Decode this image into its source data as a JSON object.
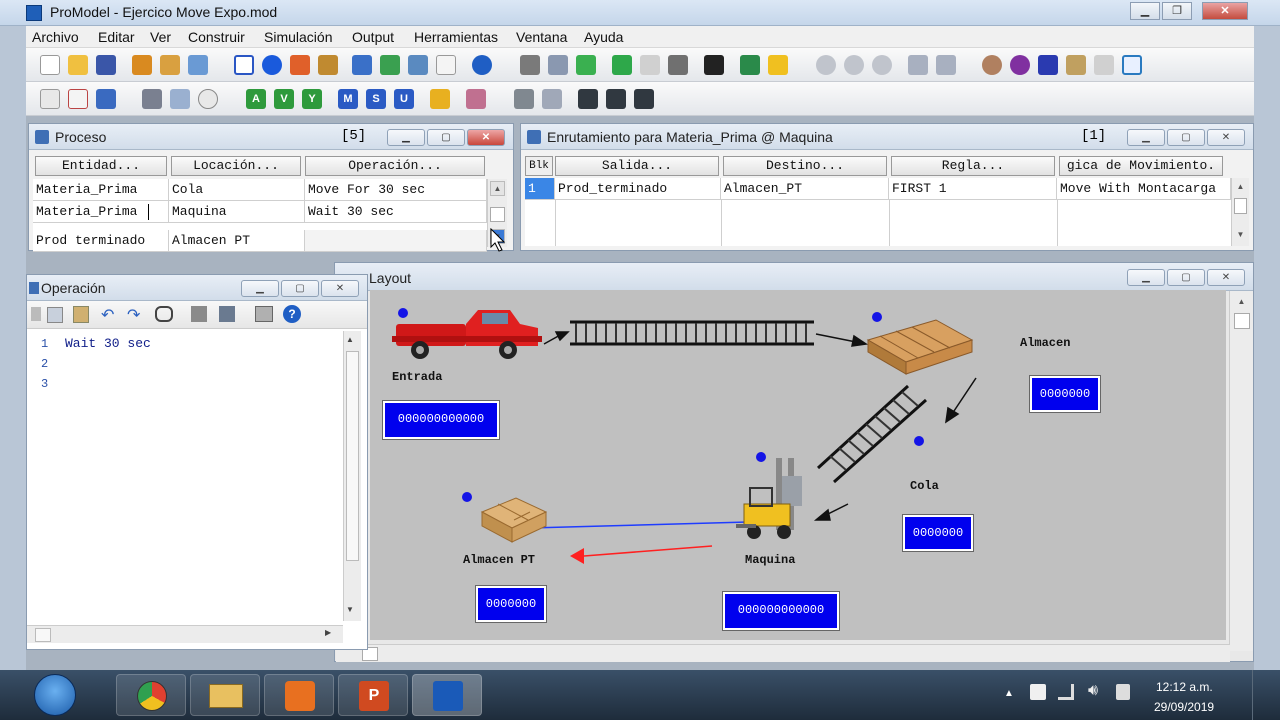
{
  "app": {
    "title": "ProModel - Ejercico Move Expo.mod"
  },
  "menu": [
    "Archivo",
    "Editar",
    "Ver",
    "Construir",
    "Simulación",
    "Output",
    "Herramientas",
    "Ventana",
    "Ayuda"
  ],
  "proceso": {
    "title": "Proceso",
    "count": "[5]",
    "headers": [
      "Entidad...",
      "Locación...",
      "Operación..."
    ],
    "rows": [
      [
        "Materia_Prima",
        "Cola",
        "Move For 30 sec"
      ],
      [
        "Materia_Prima",
        "Maquina",
        "Wait 30 sec"
      ],
      [
        "Prod terminado",
        "Almacen PT",
        ""
      ]
    ]
  },
  "routing": {
    "title": "Enrutamiento para Materia_Prima @ Maquina",
    "count": "[1]",
    "headers": [
      "Blk",
      "Salida...",
      "Destino...",
      "Regla...",
      "gica de Movimiento."
    ],
    "rows": [
      [
        "1",
        "Prod_terminado",
        "Almacen_PT",
        "FIRST 1",
        "Move With Montacarga"
      ]
    ]
  },
  "operacion": {
    "title": "Operación",
    "lines": [
      {
        "num": "1",
        "text": "Wait 30 sec"
      },
      {
        "num": "2",
        "text": ""
      },
      {
        "num": "3",
        "text": ""
      }
    ]
  },
  "layout": {
    "title": "Layout",
    "labels": {
      "entrada": "Entrada",
      "almacen": "Almacen",
      "cola": "Cola",
      "maquina": "Maquina",
      "almacen_pt": "Almacen PT"
    },
    "counters": {
      "entrada": "000000000000",
      "almacen": "0000000",
      "cola": "0000000",
      "maquina": "000000000000",
      "almacen_pt": "0000000"
    }
  },
  "taskbar": {
    "time": "12:12 a.m.",
    "date": "29/09/2019"
  },
  "colors": {
    "counter_bg": "#0000ee",
    "canvas_bg": "#c0c0c0",
    "route_red": "#ff2020",
    "route_blue": "#1e3cff"
  }
}
